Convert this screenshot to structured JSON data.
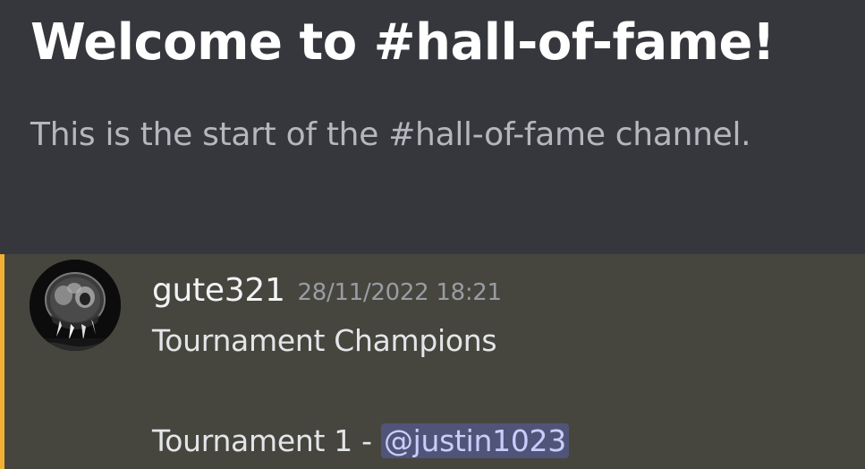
{
  "channel": {
    "welcome_title": "Welcome to #hall-of-fame!",
    "welcome_subtitle": "This is the start of the #hall-of-fame channel."
  },
  "message": {
    "author": "gute321",
    "timestamp": "28/11/2022 18:21",
    "line1": "Tournament Champions",
    "line2_prefix": "Tournament 1 - ",
    "mention": "@justin1023"
  },
  "colors": {
    "background": "#36373d",
    "highlighted_message_bg": "#46463f",
    "highlight_bar": "#f0b132",
    "mention_bg": "#505478",
    "mention_text": "#c9cdfb"
  }
}
